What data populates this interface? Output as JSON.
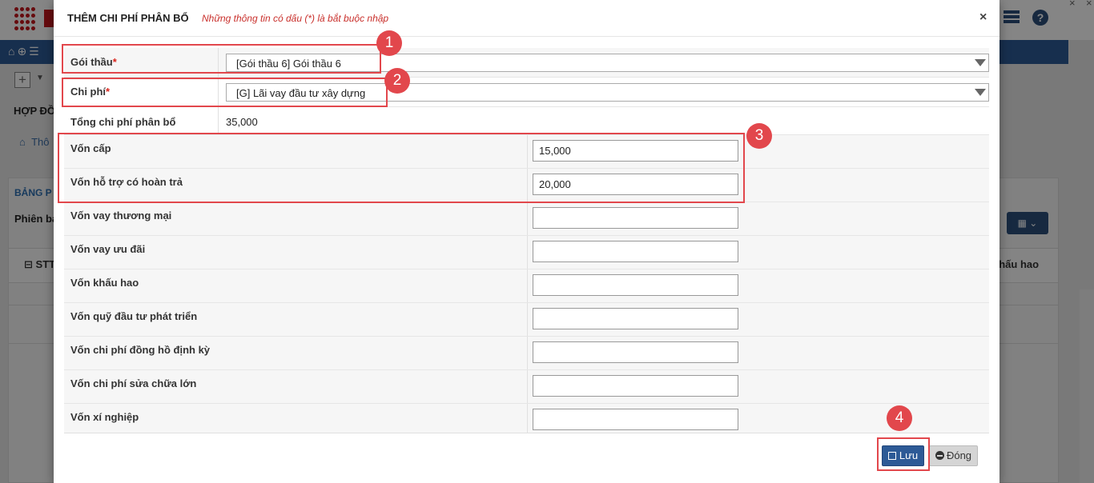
{
  "background": {
    "section_title": "HỢP ĐỒ",
    "breadcrumb": "Thô",
    "panel_title": "BẢNG P",
    "phien_label": "Phiên ba",
    "stt_header": "STT",
    "khauhao_header": "khấu hao"
  },
  "modal": {
    "title": "THÊM CHI PHÍ PHÂN BỔ",
    "note": "Những thông tin có dấu (*) là bắt buộc nhập",
    "close_symbol": "×"
  },
  "form": {
    "goi_thau": {
      "label": "Gói thầu",
      "required": "*",
      "value": "[Gói thầu 6] Gói thầu 6"
    },
    "chi_phi": {
      "label": "Chi phí",
      "required": "*",
      "value": "[G] Lãi vay đầu tư xây dựng"
    },
    "tong_chi_phi": {
      "label": "Tổng chi phí phân bổ",
      "value": "35,000"
    },
    "sources": [
      {
        "label": "Vốn cấp",
        "value": "15,000"
      },
      {
        "label": "Vốn hỗ trợ có hoàn trả",
        "value": "20,000"
      },
      {
        "label": "Vốn vay thương mại",
        "value": ""
      },
      {
        "label": "Vốn vay ưu đãi",
        "value": ""
      },
      {
        "label": "Vốn khấu hao",
        "value": ""
      },
      {
        "label": "Vốn quỹ đầu tư phát triển",
        "value": ""
      },
      {
        "label": "Vốn chi phí đồng hồ định kỳ",
        "value": ""
      },
      {
        "label": "Vốn chi phí sửa chữa lớn",
        "value": ""
      },
      {
        "label": "Vốn xí nghiệp",
        "value": ""
      }
    ]
  },
  "footer": {
    "save_label": "Lưu",
    "close_label": "Đóng"
  },
  "annotations": [
    "1",
    "2",
    "3",
    "4"
  ],
  "colors": {
    "accent": "#2d5a96",
    "required": "#d9241c",
    "annotation": "#e2474c"
  }
}
